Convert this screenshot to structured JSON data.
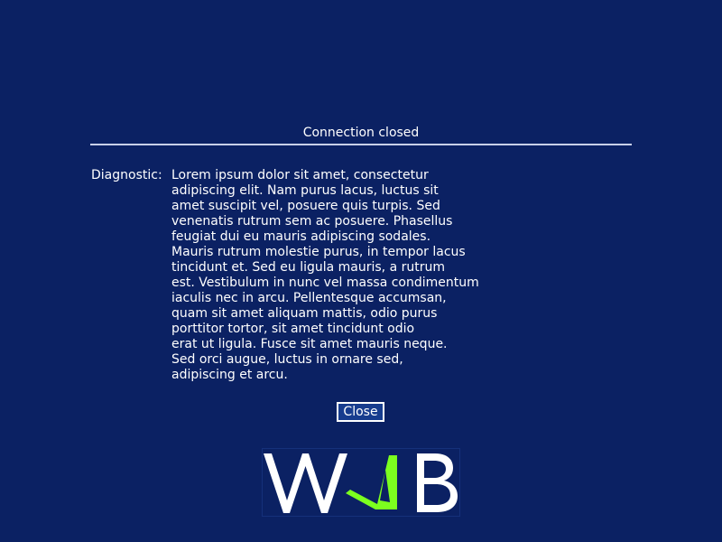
{
  "dialog": {
    "title": "Connection closed",
    "diagnostic_label": "Diagnostic:",
    "diagnostic_lines": [
      "Lorem ipsum dolor sit amet, consectetur",
      "adipiscing elit. Nam purus lacus, luctus sit",
      "amet suscipit vel, posuere quis turpis. Sed",
      "venenatis rutrum sem ac posuere. Phasellus",
      "feugiat dui eu mauris adipiscing sodales.",
      "Mauris rutrum molestie purus, in tempor lacus",
      "tincidunt et. Sed eu ligula mauris, a rutrum",
      "est. Vestibulum in nunc vel massa condimentum",
      "iaculis nec in arcu. Pellentesque accumsan,",
      "quam sit amet aliquam mattis, odio purus",
      "porttitor tortor, sit amet tincidunt odio",
      "erat ut ligula. Fusce sit amet mauris neque.",
      "Sed orci augue, luctus in ornare sed,",
      "adipiscing et arcu."
    ],
    "close_label": "Close"
  },
  "logo": {
    "text": "WAB",
    "letter_color": "#ffffff",
    "accent_color": "#7cff1f"
  },
  "colors": {
    "background": "#0b2163",
    "button_background": "#173c8e",
    "divider": "#c8d0e8"
  }
}
